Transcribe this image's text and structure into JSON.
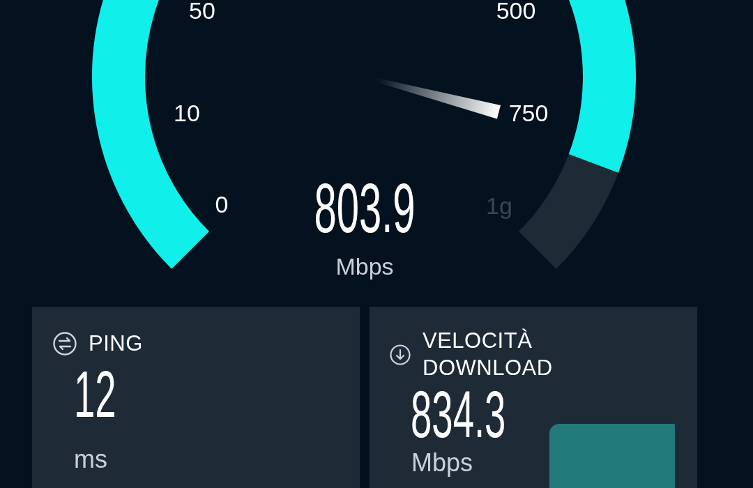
{
  "gauge": {
    "ticks": [
      "0",
      "10",
      "50",
      "500",
      "750",
      "1g"
    ],
    "reading": "803.9",
    "unit": "Mbps"
  },
  "cards": [
    {
      "kind": "ping",
      "title": "PING",
      "value": "12",
      "unit": "ms",
      "redacted": false
    },
    {
      "kind": "download",
      "title": "VELOCITÀ DOWNLOAD",
      "value": "834.3",
      "unit": "Mbps",
      "redacted": true
    }
  ]
}
